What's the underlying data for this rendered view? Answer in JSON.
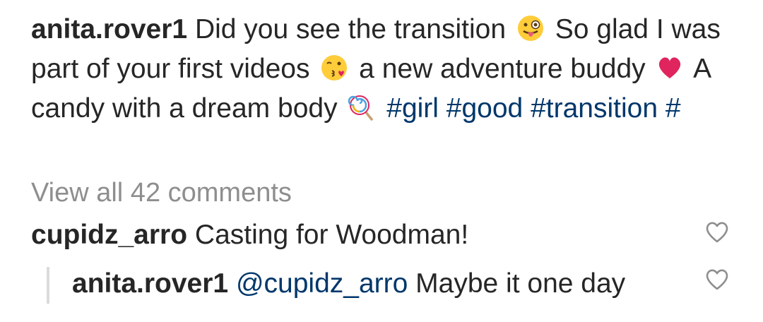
{
  "post": {
    "author": "anita.rover1",
    "caption_part1": " Did you see the transition ",
    "emoji_1": "winking-face-with-tongue-icon",
    "caption_part2": " So glad I was part of your first videos ",
    "emoji_2": "face-blowing-kiss-icon",
    "caption_part3": " a new adventure buddy ",
    "emoji_3": "red-heart-icon",
    "caption_part4": " A candy with a dream body ",
    "emoji_4": "lollipop-icon",
    "hashtags": [
      "#girl",
      "#good",
      "#transition",
      "#"
    ]
  },
  "view_all_comments": "View all 42 comments",
  "comments": [
    {
      "username": "cupidz_arro",
      "text": " Casting for Woodman!"
    }
  ],
  "replies": [
    {
      "username": "anita.rover1",
      "mention": "@cupidz_arro",
      "text": " Maybe it one day"
    }
  ],
  "colors": {
    "text": "#262626",
    "secondary": "#8e8e8e",
    "link": "#00376b",
    "heart": "#e0245e"
  }
}
